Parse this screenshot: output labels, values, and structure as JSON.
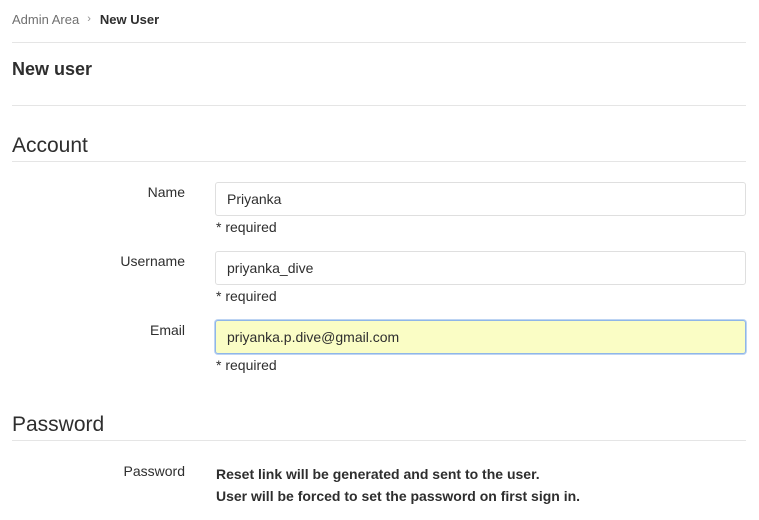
{
  "breadcrumb": {
    "parent": "Admin Area",
    "separator": "›",
    "current": "New User"
  },
  "page": {
    "title": "New user"
  },
  "account": {
    "section_title": "Account",
    "fields": {
      "name": {
        "label": "Name",
        "value": "Priyanka",
        "help": "* required"
      },
      "username": {
        "label": "Username",
        "value": "priyanka_dive",
        "help": "* required"
      },
      "email": {
        "label": "Email",
        "value": "priyanka.p.dive@gmail.com",
        "help": "* required"
      }
    }
  },
  "password": {
    "section_title": "Password",
    "label": "Password",
    "line1": "Reset link will be generated and sent to the user.",
    "line2": "User will be forced to set the password on first sign in."
  },
  "colors": {
    "autofill_background": "#fafdc5",
    "autofill_border": "#8fb6e8"
  }
}
